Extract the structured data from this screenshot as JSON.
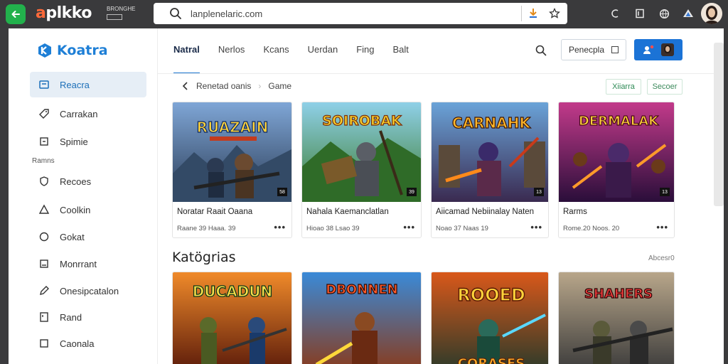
{
  "browser": {
    "brand_prefix": "a",
    "brand_rest": "plkko",
    "mini_tab_label": "BRONGHE",
    "url": "lanplenelaric.com"
  },
  "sidebar": {
    "logo": "Koatra",
    "section_title": "Ramns",
    "items": [
      {
        "label": "Reacra"
      },
      {
        "label": "Carrakan"
      },
      {
        "label": "Spimie"
      },
      {
        "label": "Recoes"
      },
      {
        "label": "Coolkin"
      },
      {
        "label": "Gokat"
      },
      {
        "label": "Monrrant"
      },
      {
        "label": "Onesipcatalon"
      },
      {
        "label": "Rand"
      },
      {
        "label": "Caonala"
      }
    ]
  },
  "topnav": {
    "tabs": [
      {
        "label": "Natral"
      },
      {
        "label": "Nerlos"
      },
      {
        "label": "Kcans"
      },
      {
        "label": "Uerdan"
      },
      {
        "label": "Fing"
      },
      {
        "label": "Balt"
      }
    ],
    "prep_button": "Penecpla"
  },
  "breadcrumb": {
    "parent": "Renetad oanis",
    "current": "Game"
  },
  "pills": [
    "Xiiarra",
    "Secoer"
  ],
  "games": [
    {
      "art_title": "RUAZAIN",
      "title": "Noratar Raait Oaana",
      "meta": "Raane 39  Haaa. 39",
      "badge": "58",
      "color": "#2c64b6"
    },
    {
      "art_title": "SOIROBAK",
      "title": "Nahala Kaemanclatlan",
      "meta": "Hioao 38   Lsao 39",
      "badge": "39",
      "color": "#3b8a3b"
    },
    {
      "art_title": "CARNAHK",
      "title": "Aiicamad Nebiinalay Naten",
      "meta": "Noao 37   Naas 19",
      "badge": "13",
      "color": "#b04a28"
    },
    {
      "art_title": "DERMALAK",
      "title": "Rarms",
      "meta": "Rome.20   Noos. 20",
      "badge": "13",
      "color": "#8a2b7a"
    }
  ],
  "categories": {
    "title": "Katögrias",
    "link": "Abcesr0",
    "items": [
      {
        "art_title": "DUCADUN",
        "color": "#c8452a"
      },
      {
        "art_title": "DBONNEN",
        "color": "#2d6cc0"
      },
      {
        "art_title": "ROOED",
        "art_sub": "CORASES",
        "color": "#d9781f"
      },
      {
        "art_title": "SHAHERS",
        "color": "#4a4a4a"
      }
    ]
  }
}
